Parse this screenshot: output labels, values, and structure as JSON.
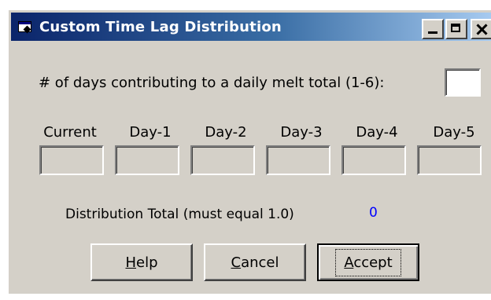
{
  "window": {
    "title": "Custom Time Lag Distribution"
  },
  "form": {
    "days_label": "# of days contributing to a daily melt total (1-6):",
    "days_value": "",
    "columns": [
      "Current",
      "Day-1",
      "Day-2",
      "Day-3",
      "Day-4",
      "Day-5"
    ],
    "column_values": [
      "",
      "",
      "",
      "",
      "",
      ""
    ],
    "total_label": "Distribution Total (must equal 1.0)",
    "total_value": "0"
  },
  "buttons": {
    "help": {
      "mnemonic": "H",
      "rest": "elp"
    },
    "cancel": {
      "mnemonic": "C",
      "rest": "ancel"
    },
    "accept": {
      "mnemonic": "A",
      "rest": "ccept"
    }
  },
  "colors": {
    "title_gradient_start": "#0a246a",
    "title_gradient_end": "#a6caf0",
    "dialog_face": "#d4d0c8",
    "total_value_color": "#0000ff"
  }
}
